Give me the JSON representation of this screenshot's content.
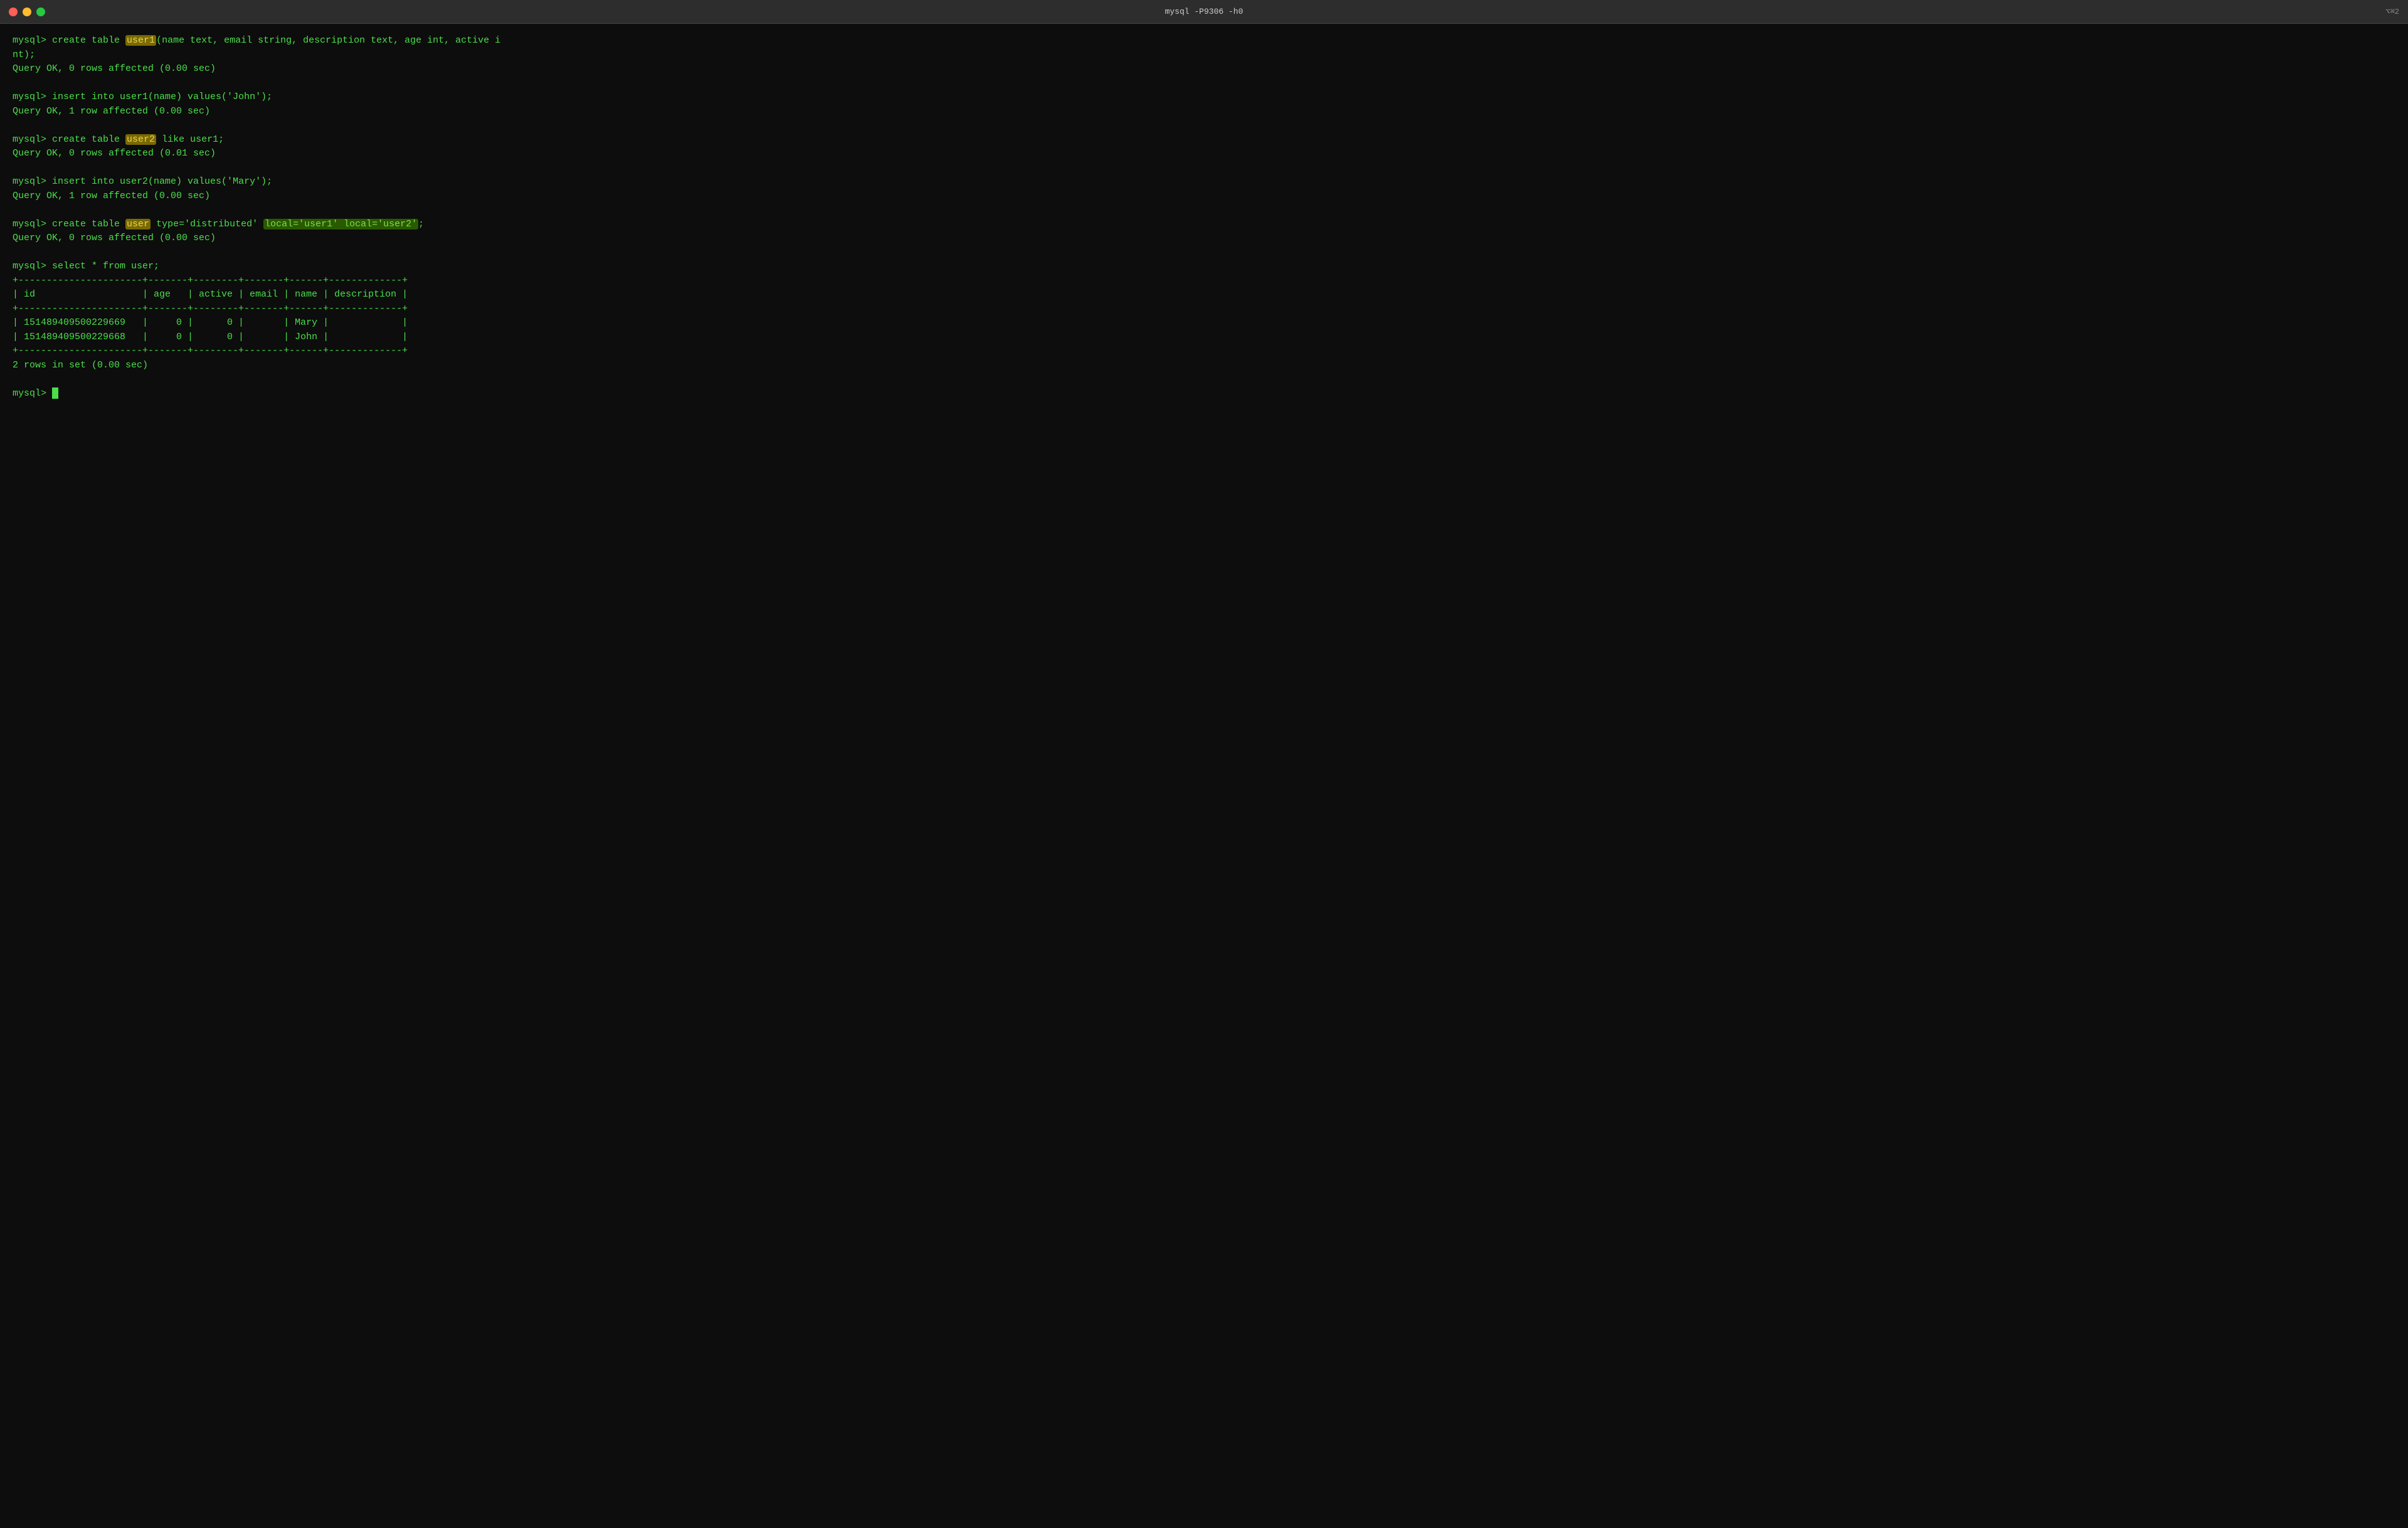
{
  "window": {
    "title": "mysql -P9306 -h0",
    "keyboard_shortcut": "⌥⌘2"
  },
  "controls": {
    "close_label": "close",
    "minimize_label": "minimize",
    "maximize_label": "maximize"
  },
  "terminal": {
    "lines": [
      {
        "type": "command",
        "prefix": "mysql> ",
        "parts": [
          {
            "text": "create table ",
            "style": "normal"
          },
          {
            "text": "user1",
            "style": "highlight-yellow"
          },
          {
            "text": "(name text, email string, description text, age int, active i",
            "style": "normal"
          }
        ]
      },
      {
        "type": "continuation",
        "text": "nt);"
      },
      {
        "type": "output",
        "text": "Query OK, 0 rows affected (0.00 sec)"
      },
      {
        "type": "empty"
      },
      {
        "type": "command",
        "prefix": "mysql> ",
        "parts": [
          {
            "text": "insert into user1(name) values('John');",
            "style": "normal"
          }
        ]
      },
      {
        "type": "output",
        "text": "Query OK, 1 row affected (0.00 sec)"
      },
      {
        "type": "empty"
      },
      {
        "type": "command",
        "prefix": "mysql> ",
        "parts": [
          {
            "text": "create table ",
            "style": "normal"
          },
          {
            "text": "user2",
            "style": "highlight-yellow"
          },
          {
            "text": " like user1;",
            "style": "normal"
          }
        ]
      },
      {
        "type": "output",
        "text": "Query OK, 0 rows affected (0.01 sec)"
      },
      {
        "type": "empty"
      },
      {
        "type": "command",
        "prefix": "mysql> ",
        "parts": [
          {
            "text": "insert into user2(name) values('Mary');",
            "style": "normal"
          }
        ]
      },
      {
        "type": "output",
        "text": "Query OK, 1 row affected (0.00 sec)"
      },
      {
        "type": "empty"
      },
      {
        "type": "command",
        "prefix": "mysql> ",
        "parts": [
          {
            "text": "create table ",
            "style": "normal"
          },
          {
            "text": "user",
            "style": "highlight-yellow"
          },
          {
            "text": " type='distributed' ",
            "style": "normal"
          },
          {
            "text": "local='user1' local='user2'",
            "style": "highlight-green"
          },
          {
            "text": ";",
            "style": "normal"
          }
        ]
      },
      {
        "type": "output",
        "text": "Query OK, 0 rows affected (0.00 sec)"
      },
      {
        "type": "empty"
      },
      {
        "type": "command",
        "prefix": "mysql> ",
        "parts": [
          {
            "text": "select * from user;",
            "style": "normal"
          }
        ]
      },
      {
        "type": "table_separator",
        "text": "+----------------------+-------+--------+-------+------+-------------+"
      },
      {
        "type": "table_row",
        "text": "| id                   | age   | active | email | name | description |"
      },
      {
        "type": "table_separator",
        "text": "+----------------------+-------+--------+-------+------+-------------+"
      },
      {
        "type": "table_row",
        "text": "| 151489409500229669   |     0 |      0 |       | Mary |             |"
      },
      {
        "type": "table_row",
        "text": "| 151489409500229668   |     0 |      0 |       | John |             |"
      },
      {
        "type": "table_separator",
        "text": "+----------------------+-------+--------+-------+------+-------------+"
      },
      {
        "type": "output",
        "text": "2 rows in set (0.00 sec)"
      },
      {
        "type": "empty"
      },
      {
        "type": "prompt_only",
        "prefix": "mysql> "
      }
    ]
  }
}
